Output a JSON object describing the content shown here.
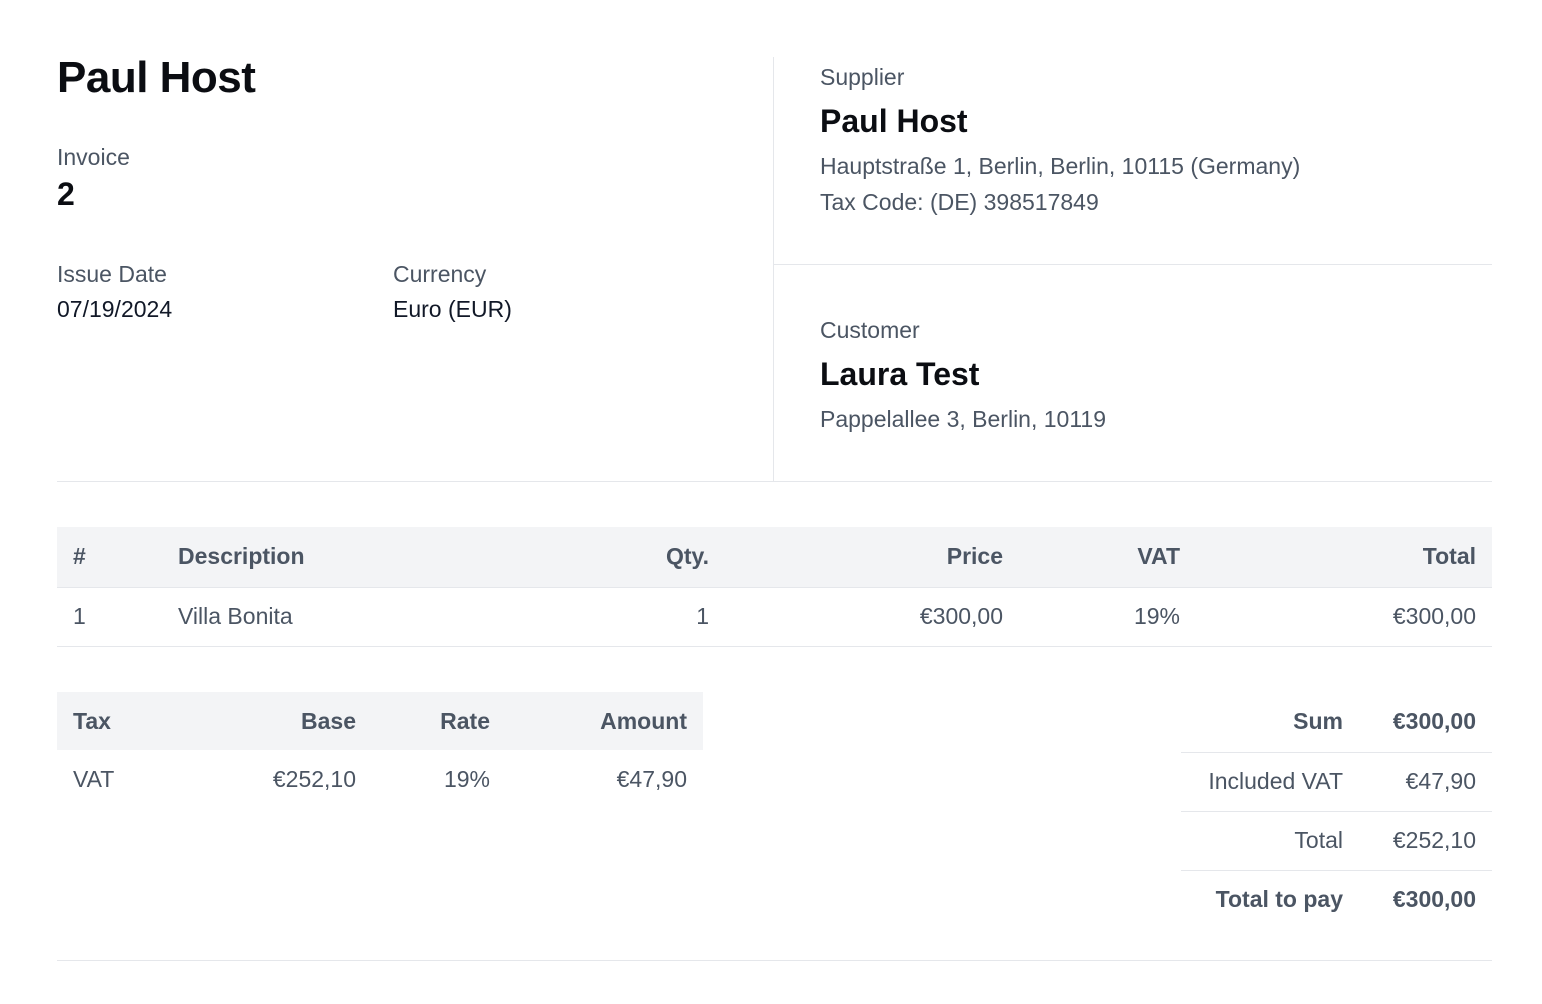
{
  "seller": {
    "name": "Paul Host"
  },
  "invoice": {
    "label": "Invoice",
    "number": "2",
    "issue_date_label": "Issue Date",
    "issue_date": "07/19/2024",
    "currency_label": "Currency",
    "currency": "Euro (EUR)"
  },
  "supplier": {
    "label": "Supplier",
    "name": "Paul Host",
    "address": "Hauptstraße 1, Berlin, Berlin, 10115 (Germany)",
    "tax_code": "Tax Code: (DE) 398517849"
  },
  "customer": {
    "label": "Customer",
    "name": "Laura Test",
    "address": "Pappelallee 3, Berlin, 10119"
  },
  "items": {
    "headers": [
      "#",
      "Description",
      "Qty.",
      "Price",
      "VAT",
      "Total"
    ],
    "rows": [
      [
        "1",
        "Villa Bonita",
        "1",
        "€300,00",
        "19%",
        "€300,00"
      ]
    ]
  },
  "taxes": {
    "headers": [
      "Tax",
      "Base",
      "Rate",
      "Amount"
    ],
    "rows": [
      [
        "VAT",
        "€252,10",
        "19%",
        "€47,90"
      ]
    ]
  },
  "totals": {
    "sum_label": "Sum",
    "sum": "€300,00",
    "included_vat_label": "Included VAT",
    "included_vat": "€47,90",
    "total_label": "Total",
    "total": "€252,10",
    "to_pay_label": "Total to pay",
    "to_pay": "€300,00"
  }
}
